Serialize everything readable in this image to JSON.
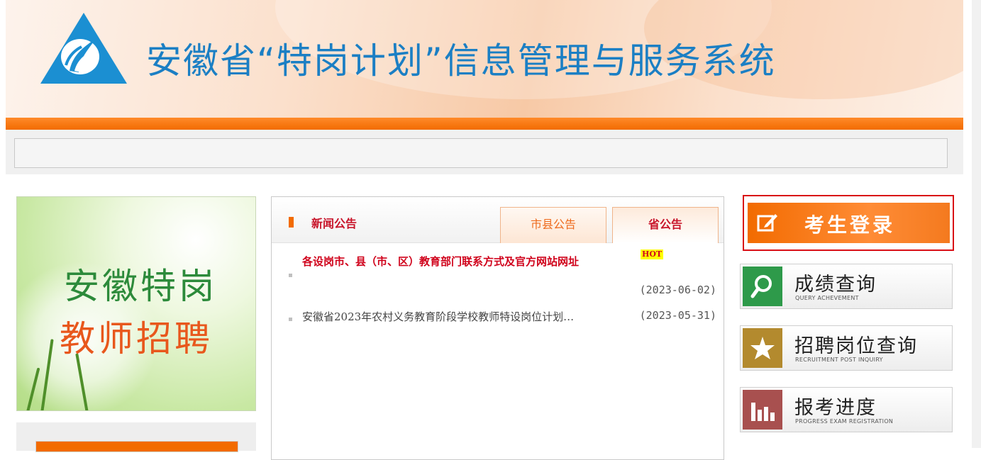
{
  "header": {
    "title": "安徽省“特岗计划”信息管理与服务系统"
  },
  "promo": {
    "line1": "安徽特岗",
    "line2": "教师招聘"
  },
  "news": {
    "section_label": "新闻公告",
    "tabs": [
      {
        "label": "市县公告",
        "active": false
      },
      {
        "label": "省公告",
        "active": true
      }
    ],
    "items": [
      {
        "title": "各设岗市、县（市、区）教育部门联系方式及官方网站网址",
        "badge": "HOT",
        "date": "(2023-06-02)"
      },
      {
        "title": "安徽省2023年农村义务教育阶段学校教师特设岗位计划…",
        "date": "(2023-05-31)"
      }
    ]
  },
  "sidebar": {
    "login": {
      "label": "考生登录",
      "icon": "edit-icon"
    },
    "buttons": [
      {
        "zh": "成绩查询",
        "en": "QUERY ACHEVEMENT",
        "icon": "search-icon",
        "color": "#2e9a4a"
      },
      {
        "zh": "招聘岗位查询",
        "en": "RECRUITMENT POST INQUIRY",
        "icon": "star-icon",
        "color": "#b38a2e"
      },
      {
        "zh": "报考进度",
        "en": "PROGRESS EXAM REGISTRATION",
        "icon": "bar-chart-icon",
        "color": "#a8504f"
      }
    ]
  }
}
